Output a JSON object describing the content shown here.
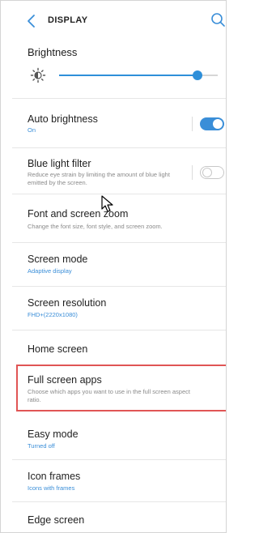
{
  "header": {
    "title": "DISPLAY",
    "back_icon": "chevron-left-icon",
    "search_icon": "search-icon"
  },
  "brightness": {
    "label": "Brightness",
    "level_fraction": 0.87,
    "icon": "brightness-sun-icon"
  },
  "items": [
    {
      "title": "Auto brightness",
      "subtitle": "On",
      "subtitle_style": "accent",
      "toggle": "on"
    },
    {
      "title": "Blue light filter",
      "subtitle": "Reduce eye strain by limiting the amount of blue light emitted by the screen.",
      "subtitle_style": "muted",
      "toggle": "off"
    },
    {
      "title": "Font and screen zoom",
      "subtitle": "Change the font size, font style, and screen zoom.",
      "subtitle_style": "muted"
    },
    {
      "title": "Screen mode",
      "subtitle": "Adaptive display",
      "subtitle_style": "accent"
    },
    {
      "title": "Screen resolution",
      "subtitle": "FHD+(2220x1080)",
      "subtitle_style": "accent"
    },
    {
      "title": "Home screen",
      "subtitle": ""
    },
    {
      "title": "Full screen apps",
      "subtitle": "Choose which apps you want to use in the full screen aspect ratio.",
      "subtitle_style": "muted",
      "highlighted": true
    },
    {
      "title": "Easy mode",
      "subtitle": "Turned off",
      "subtitle_style": "accent"
    },
    {
      "title": "Icon frames",
      "subtitle": "Icons with frames",
      "subtitle_style": "accent"
    },
    {
      "title": "Edge screen",
      "subtitle": ""
    }
  ],
  "colors": {
    "accent": "#3a8ed8",
    "highlight_border": "#e05555",
    "muted_text": "#8a8a8a"
  }
}
